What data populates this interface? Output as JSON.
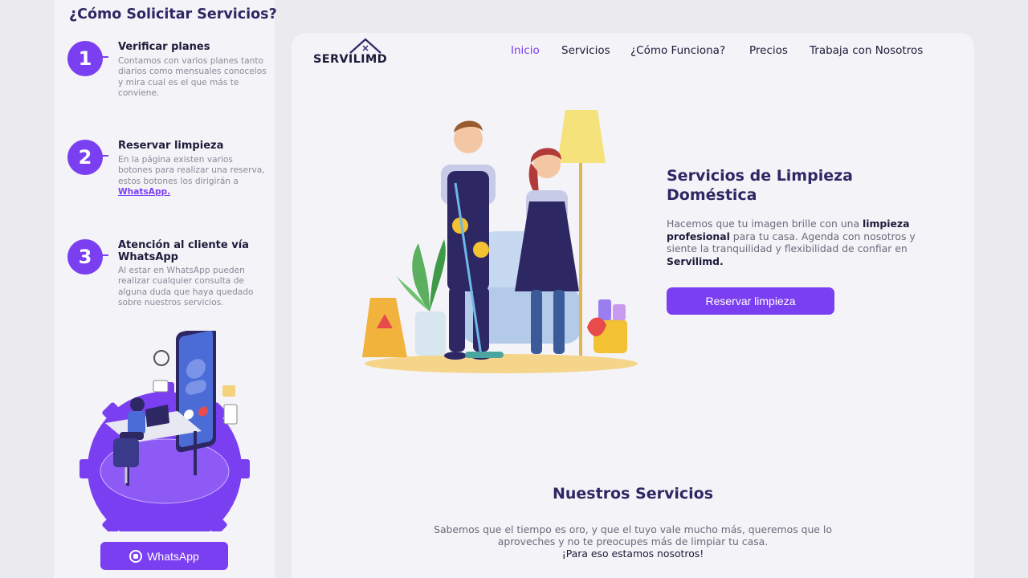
{
  "sidebar": {
    "title": "¿Cómo Solicitar Servicios?",
    "steps": [
      {
        "num": "1",
        "title": "Verificar planes",
        "desc": "Contamos con varios planes tanto diarios como mensuales conocelos y mira cual es el que más te conviene."
      },
      {
        "num": "2",
        "title": "Reservar limpieza",
        "desc_pre": "En la página existen varios botones para realizar una reserva, estos botones los dirigirán a ",
        "desc_link": "WhatsApp."
      },
      {
        "num": "3",
        "title": "Atención al cliente vía WhatsApp",
        "desc": "Al estar en WhatsApp pueden realizar cualquier consulta de alguna duda que haya quedado sobre nuestros servicios."
      }
    ],
    "whatsapp_button": "WhatsApp"
  },
  "header": {
    "logo": "SERVILIMD",
    "nav": [
      "Inicio",
      "Servicios",
      "¿Cómo Funciona?",
      "Precios",
      "Trabaja con Nosotros"
    ],
    "active_nav": "Inicio"
  },
  "hero": {
    "title": "Servicios de Limpieza Doméstica",
    "text_1": "Hacemos que tu imagen brille con una ",
    "text_bold_1": "limpieza profesional",
    "text_2": " para tu casa. Agenda con nosotros y siente la tranquilidad y flexibilidad de confiar en ",
    "text_bold_2": "Servilimd.",
    "button": "Reservar limpieza"
  },
  "services": {
    "title": "Nuestros Servicios",
    "text": "Sabemos que el tiempo es oro, y que el tuyo vale mucho más, queremos que lo aproveches y no te preocupes más de limpiar tu casa.",
    "strong": "¡Para eso estamos nosotros!"
  },
  "colors": {
    "accent": "#7b3ff2",
    "heading": "#2d2763",
    "background": "#ebeaef"
  },
  "icons": [
    "whatsapp-icon",
    "house-roof-logo-icon"
  ]
}
